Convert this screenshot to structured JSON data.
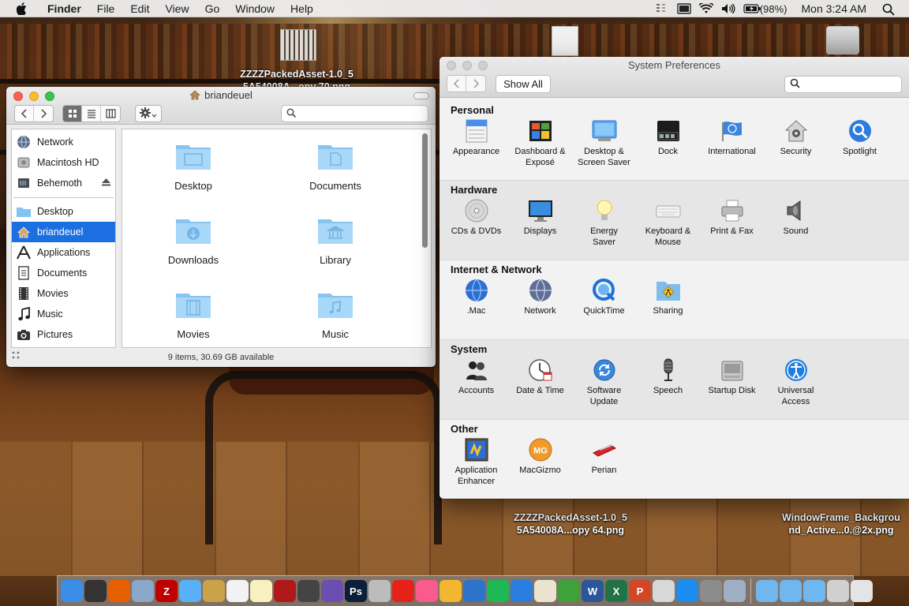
{
  "menubar": {
    "app_name": "Finder",
    "menus": [
      "File",
      "Edit",
      "View",
      "Go",
      "Window",
      "Help"
    ],
    "battery": "(98%)",
    "clock": "Mon 3:24 AM"
  },
  "desktop": {
    "icons": [
      {
        "label_line1": "ZZZZPackedAsset-1.0_5",
        "label_line2": "5A54008A...opy 70.png"
      },
      {
        "label_line1": "ZZZZPackedAsset-1.0_5",
        "label_line2": "5A54008A...opy 64.png"
      },
      {
        "label_line1": "WindowFrame_Backgrou",
        "label_line2": "nd_Active...0.@2x.png"
      }
    ]
  },
  "finder": {
    "title": "briandeuel",
    "search_placeholder": "",
    "sidebar": [
      {
        "label": "Network",
        "icon": "globe-icon"
      },
      {
        "label": "Macintosh HD",
        "icon": "hard-drive-icon"
      },
      {
        "label": "Behemoth",
        "icon": "external-drive-icon",
        "ejectable": true
      },
      {
        "label": "Desktop",
        "icon": "desktop-folder-icon"
      },
      {
        "label": "briandeuel",
        "icon": "home-icon",
        "selected": true
      },
      {
        "label": "Applications",
        "icon": "applications-icon"
      },
      {
        "label": "Documents",
        "icon": "documents-icon"
      },
      {
        "label": "Movies",
        "icon": "film-icon"
      },
      {
        "label": "Music",
        "icon": "music-note-icon"
      },
      {
        "label": "Pictures",
        "icon": "camera-icon"
      }
    ],
    "items": [
      {
        "label": "Desktop",
        "icon": "desktop-folder-icon"
      },
      {
        "label": "Documents",
        "icon": "documents-folder-icon"
      },
      {
        "label": "Downloads",
        "icon": "downloads-folder-icon"
      },
      {
        "label": "Library",
        "icon": "library-folder-icon"
      },
      {
        "label": "Movies",
        "icon": "movies-folder-icon"
      },
      {
        "label": "Music",
        "icon": "music-folder-icon"
      }
    ],
    "status": "9 items, 30.69 GB available"
  },
  "syspref": {
    "title": "System Preferences",
    "show_all": "Show All",
    "search_placeholder": "",
    "sections": [
      {
        "title": "Personal",
        "panes": [
          {
            "l1": "Appearance",
            "l2": "",
            "icon": "appearance-icon"
          },
          {
            "l1": "Dashboard &",
            "l2": "Exposé",
            "icon": "dashboard-icon"
          },
          {
            "l1": "Desktop &",
            "l2": "Screen Saver",
            "icon": "desktop-icon"
          },
          {
            "l1": "Dock",
            "l2": "",
            "icon": "dock-icon"
          },
          {
            "l1": "International",
            "l2": "",
            "icon": "flag-icon"
          },
          {
            "l1": "Security",
            "l2": "",
            "icon": "house-lock-icon"
          },
          {
            "l1": "Spotlight",
            "l2": "",
            "icon": "spotlight-icon"
          }
        ]
      },
      {
        "title": "Hardware",
        "panes": [
          {
            "l1": "CDs & DVDs",
            "l2": "",
            "icon": "disc-icon"
          },
          {
            "l1": "Displays",
            "l2": "",
            "icon": "monitor-icon"
          },
          {
            "l1": "Energy",
            "l2": "Saver",
            "icon": "lightbulb-icon"
          },
          {
            "l1": "Keyboard &",
            "l2": "Mouse",
            "icon": "keyboard-icon"
          },
          {
            "l1": "Print & Fax",
            "l2": "",
            "icon": "printer-icon"
          },
          {
            "l1": "Sound",
            "l2": "",
            "icon": "speaker-icon"
          }
        ]
      },
      {
        "title": "Internet & Network",
        "panes": [
          {
            "l1": ".Mac",
            "l2": "",
            "icon": "globe-icon"
          },
          {
            "l1": "Network",
            "l2": "",
            "icon": "network-globe-icon"
          },
          {
            "l1": "QuickTime",
            "l2": "",
            "icon": "quicktime-icon"
          },
          {
            "l1": "Sharing",
            "l2": "",
            "icon": "sharing-folder-icon"
          }
        ]
      },
      {
        "title": "System",
        "panes": [
          {
            "l1": "Accounts",
            "l2": "",
            "icon": "people-icon"
          },
          {
            "l1": "Date & Time",
            "l2": "",
            "icon": "clock-icon"
          },
          {
            "l1": "Software",
            "l2": "Update",
            "icon": "update-icon"
          },
          {
            "l1": "Speech",
            "l2": "",
            "icon": "microphone-icon"
          },
          {
            "l1": "Startup Disk",
            "l2": "",
            "icon": "disk-icon"
          },
          {
            "l1": "Universal",
            "l2": "Access",
            "icon": "accessibility-icon"
          }
        ]
      },
      {
        "title": "Other",
        "panes": [
          {
            "l1": "Application",
            "l2": "Enhancer",
            "icon": "app-enhancer-icon"
          },
          {
            "l1": "MacGizmo",
            "l2": "",
            "icon": "macgizmo-icon"
          },
          {
            "l1": "Perian",
            "l2": "",
            "icon": "perian-icon"
          }
        ]
      }
    ]
  },
  "dock": {
    "apps": [
      {
        "icon": "finder-icon",
        "color": "#3b8ee8"
      },
      {
        "icon": "dashboard-icon",
        "color": "#333333"
      },
      {
        "icon": "firefox-icon",
        "color": "#e66000"
      },
      {
        "icon": "preview-icon",
        "color": "#8aa6c8"
      },
      {
        "icon": "filezilla-icon",
        "color": "#bf0000",
        "glyph": "Z"
      },
      {
        "icon": "messages-icon",
        "color": "#5ab0f5"
      },
      {
        "icon": "notes-folder-icon",
        "color": "#c9a24a"
      },
      {
        "icon": "calendar-icon",
        "color": "#f2f2f2"
      },
      {
        "icon": "stickies-icon",
        "color": "#f7f1c0"
      },
      {
        "icon": "photo-booth-icon",
        "color": "#b01919"
      },
      {
        "icon": "media-icon",
        "color": "#444444"
      },
      {
        "icon": "imovie-icon",
        "color": "#6a4fb0"
      },
      {
        "icon": "photoshop-icon",
        "color": "#0b1e3a",
        "glyph": "Ps"
      },
      {
        "icon": "preview-photos-icon",
        "color": "#bcbcbc"
      },
      {
        "icon": "youtube-icon",
        "color": "#e62117"
      },
      {
        "icon": "itunes-icon",
        "color": "#fa5a8c"
      },
      {
        "icon": "photos-icon",
        "color": "#f2b631"
      },
      {
        "icon": "quicktime-icon",
        "color": "#2d74c9"
      },
      {
        "icon": "spotify-icon",
        "color": "#1db954"
      },
      {
        "icon": "keynote-icon",
        "color": "#2b7de0"
      },
      {
        "icon": "textedit-icon",
        "color": "#e9e3cf"
      },
      {
        "icon": "numbers-icon",
        "color": "#3fa13a"
      },
      {
        "icon": "word-icon",
        "color": "#2b579a",
        "glyph": "W"
      },
      {
        "icon": "excel-icon",
        "color": "#217346",
        "glyph": "X"
      },
      {
        "icon": "powerpoint-icon",
        "color": "#d24726",
        "glyph": "P"
      },
      {
        "icon": "image-capture-icon",
        "color": "#d8d8d8"
      },
      {
        "icon": "app-store-icon",
        "color": "#1d8cf0"
      },
      {
        "icon": "system-preferences-icon",
        "color": "#8c8c8c"
      },
      {
        "icon": "screenshot-icon",
        "color": "#9fb0c4"
      }
    ],
    "stacks": [
      {
        "icon": "applications-stack-icon",
        "color": "#6fb7ee"
      },
      {
        "icon": "documents-stack-icon",
        "color": "#6fb7ee"
      },
      {
        "icon": "downloads-stack-icon",
        "color": "#6fb7ee"
      },
      {
        "icon": "files-stack-icon",
        "color": "#d0d0d0"
      },
      {
        "icon": "trash-icon",
        "color": "#e4e4e4"
      }
    ]
  }
}
